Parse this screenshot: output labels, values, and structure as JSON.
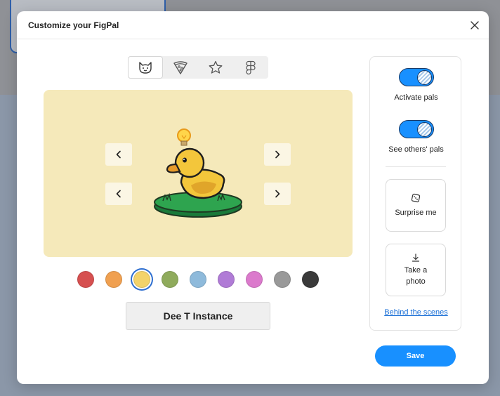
{
  "dialog": {
    "title": "Customize your FigPal"
  },
  "tabs": [
    {
      "icon": "cat-face-icon",
      "active": true
    },
    {
      "icon": "pizza-slice-icon",
      "active": false
    },
    {
      "icon": "star-icon",
      "active": false
    },
    {
      "icon": "figma-logo-icon",
      "active": false
    }
  ],
  "stage": {
    "background": "#f5e9ba"
  },
  "swatches": [
    {
      "color": "#d65050",
      "selected": false
    },
    {
      "color": "#f0a050",
      "selected": false
    },
    {
      "color": "#f3d36a",
      "selected": true
    },
    {
      "color": "#8fab5c",
      "selected": false
    },
    {
      "color": "#8ebadb",
      "selected": false
    },
    {
      "color": "#b07bd6",
      "selected": false
    },
    {
      "color": "#db7acc",
      "selected": false
    },
    {
      "color": "#999999",
      "selected": false
    },
    {
      "color": "#3a3a3a",
      "selected": false
    }
  ],
  "name_button": {
    "label": "Dee T Instance"
  },
  "settings": {
    "activate_label": "Activate pals",
    "activate_on": true,
    "see_others_label": "See others' pals",
    "see_others_on": true,
    "surprise_label": "Surprise me",
    "photo_label_line1": "Take a",
    "photo_label_line2": "photo",
    "behind_link": "Behind the scenes"
  },
  "footer": {
    "save_label": "Save"
  },
  "colors": {
    "accent": "#1890ff",
    "link": "#1a6fd6"
  }
}
